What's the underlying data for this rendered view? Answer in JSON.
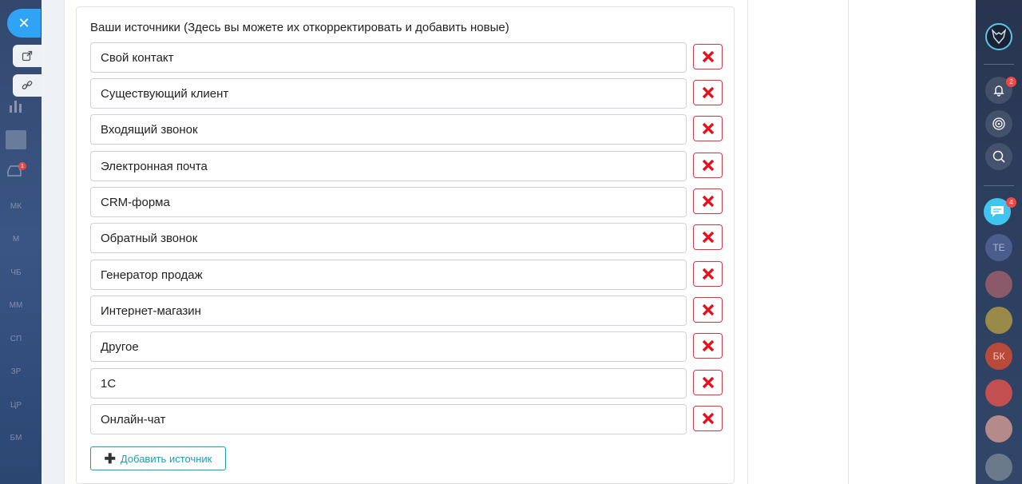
{
  "left_sidebar": {
    "close_label": "✕",
    "glyphs": [
      "МК",
      "М",
      "ЧБ",
      "ММ",
      "СП",
      "ЗР",
      "ЦР",
      "БМ"
    ],
    "badge": "1"
  },
  "card": {
    "title": "Ваши источники (Здесь вы можете их откорректировать и добавить новые)",
    "sources": [
      "Свой контакт",
      "Существующий клиент",
      "Входящий звонок",
      "Электронная почта",
      "CRM-форма",
      "Обратный звонок",
      "Генератор продаж",
      "Интернет-магазин",
      "Другое",
      "1С",
      "Онлайн-чат"
    ],
    "add_button_label": "Добавить источник"
  },
  "right_sidebar": {
    "notifications_badge": "2",
    "chat_badge": "4",
    "avatars": [
      "ТЕ",
      "БК"
    ]
  },
  "colors": {
    "delete_red": "#dc3545",
    "add_teal": "#17a2b8",
    "close_blue": "#2fa3f5"
  }
}
